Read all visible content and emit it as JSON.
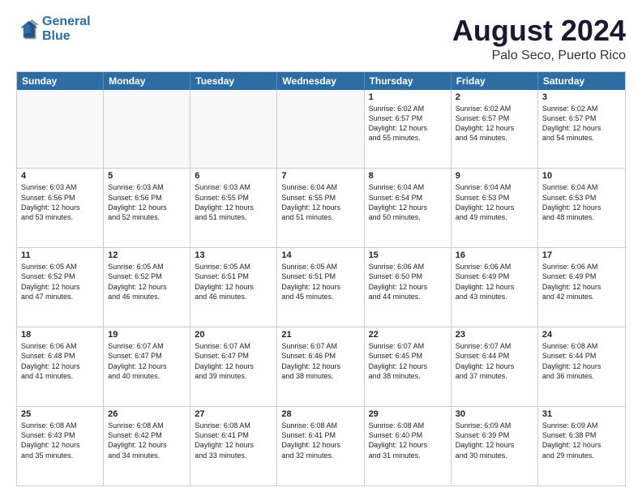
{
  "header": {
    "logo_general": "General",
    "logo_blue": "Blue",
    "title": "August 2024",
    "subtitle": "Palo Seco, Puerto Rico"
  },
  "days_of_week": [
    "Sunday",
    "Monday",
    "Tuesday",
    "Wednesday",
    "Thursday",
    "Friday",
    "Saturday"
  ],
  "weeks": [
    [
      {
        "day": "",
        "empty": true
      },
      {
        "day": "",
        "empty": true
      },
      {
        "day": "",
        "empty": true
      },
      {
        "day": "",
        "empty": true
      },
      {
        "day": "1",
        "line1": "Sunrise: 6:02 AM",
        "line2": "Sunset: 6:57 PM",
        "line3": "Daylight: 12 hours",
        "line4": "and 55 minutes."
      },
      {
        "day": "2",
        "line1": "Sunrise: 6:02 AM",
        "line2": "Sunset: 6:57 PM",
        "line3": "Daylight: 12 hours",
        "line4": "and 54 minutes."
      },
      {
        "day": "3",
        "line1": "Sunrise: 6:02 AM",
        "line2": "Sunset: 6:57 PM",
        "line3": "Daylight: 12 hours",
        "line4": "and 54 minutes."
      }
    ],
    [
      {
        "day": "4",
        "line1": "Sunrise: 6:03 AM",
        "line2": "Sunset: 6:56 PM",
        "line3": "Daylight: 12 hours",
        "line4": "and 53 minutes."
      },
      {
        "day": "5",
        "line1": "Sunrise: 6:03 AM",
        "line2": "Sunset: 6:56 PM",
        "line3": "Daylight: 12 hours",
        "line4": "and 52 minutes."
      },
      {
        "day": "6",
        "line1": "Sunrise: 6:03 AM",
        "line2": "Sunset: 6:55 PM",
        "line3": "Daylight: 12 hours",
        "line4": "and 51 minutes."
      },
      {
        "day": "7",
        "line1": "Sunrise: 6:04 AM",
        "line2": "Sunset: 6:55 PM",
        "line3": "Daylight: 12 hours",
        "line4": "and 51 minutes."
      },
      {
        "day": "8",
        "line1": "Sunrise: 6:04 AM",
        "line2": "Sunset: 6:54 PM",
        "line3": "Daylight: 12 hours",
        "line4": "and 50 minutes."
      },
      {
        "day": "9",
        "line1": "Sunrise: 6:04 AM",
        "line2": "Sunset: 6:53 PM",
        "line3": "Daylight: 12 hours",
        "line4": "and 49 minutes."
      },
      {
        "day": "10",
        "line1": "Sunrise: 6:04 AM",
        "line2": "Sunset: 6:53 PM",
        "line3": "Daylight: 12 hours",
        "line4": "and 48 minutes."
      }
    ],
    [
      {
        "day": "11",
        "line1": "Sunrise: 6:05 AM",
        "line2": "Sunset: 6:52 PM",
        "line3": "Daylight: 12 hours",
        "line4": "and 47 minutes."
      },
      {
        "day": "12",
        "line1": "Sunrise: 6:05 AM",
        "line2": "Sunset: 6:52 PM",
        "line3": "Daylight: 12 hours",
        "line4": "and 46 minutes."
      },
      {
        "day": "13",
        "line1": "Sunrise: 6:05 AM",
        "line2": "Sunset: 6:51 PM",
        "line3": "Daylight: 12 hours",
        "line4": "and 46 minutes."
      },
      {
        "day": "14",
        "line1": "Sunrise: 6:05 AM",
        "line2": "Sunset: 6:51 PM",
        "line3": "Daylight: 12 hours",
        "line4": "and 45 minutes."
      },
      {
        "day": "15",
        "line1": "Sunrise: 6:06 AM",
        "line2": "Sunset: 6:50 PM",
        "line3": "Daylight: 12 hours",
        "line4": "and 44 minutes."
      },
      {
        "day": "16",
        "line1": "Sunrise: 6:06 AM",
        "line2": "Sunset: 6:49 PM",
        "line3": "Daylight: 12 hours",
        "line4": "and 43 minutes."
      },
      {
        "day": "17",
        "line1": "Sunrise: 6:06 AM",
        "line2": "Sunset: 6:49 PM",
        "line3": "Daylight: 12 hours",
        "line4": "and 42 minutes."
      }
    ],
    [
      {
        "day": "18",
        "line1": "Sunrise: 6:06 AM",
        "line2": "Sunset: 6:48 PM",
        "line3": "Daylight: 12 hours",
        "line4": "and 41 minutes."
      },
      {
        "day": "19",
        "line1": "Sunrise: 6:07 AM",
        "line2": "Sunset: 6:47 PM",
        "line3": "Daylight: 12 hours",
        "line4": "and 40 minutes."
      },
      {
        "day": "20",
        "line1": "Sunrise: 6:07 AM",
        "line2": "Sunset: 6:47 PM",
        "line3": "Daylight: 12 hours",
        "line4": "and 39 minutes."
      },
      {
        "day": "21",
        "line1": "Sunrise: 6:07 AM",
        "line2": "Sunset: 6:46 PM",
        "line3": "Daylight: 12 hours",
        "line4": "and 38 minutes."
      },
      {
        "day": "22",
        "line1": "Sunrise: 6:07 AM",
        "line2": "Sunset: 6:45 PM",
        "line3": "Daylight: 12 hours",
        "line4": "and 38 minutes."
      },
      {
        "day": "23",
        "line1": "Sunrise: 6:07 AM",
        "line2": "Sunset: 6:44 PM",
        "line3": "Daylight: 12 hours",
        "line4": "and 37 minutes."
      },
      {
        "day": "24",
        "line1": "Sunrise: 6:08 AM",
        "line2": "Sunset: 6:44 PM",
        "line3": "Daylight: 12 hours",
        "line4": "and 36 minutes."
      }
    ],
    [
      {
        "day": "25",
        "line1": "Sunrise: 6:08 AM",
        "line2": "Sunset: 6:43 PM",
        "line3": "Daylight: 12 hours",
        "line4": "and 35 minutes."
      },
      {
        "day": "26",
        "line1": "Sunrise: 6:08 AM",
        "line2": "Sunset: 6:42 PM",
        "line3": "Daylight: 12 hours",
        "line4": "and 34 minutes."
      },
      {
        "day": "27",
        "line1": "Sunrise: 6:08 AM",
        "line2": "Sunset: 6:41 PM",
        "line3": "Daylight: 12 hours",
        "line4": "and 33 minutes."
      },
      {
        "day": "28",
        "line1": "Sunrise: 6:08 AM",
        "line2": "Sunset: 6:41 PM",
        "line3": "Daylight: 12 hours",
        "line4": "and 32 minutes."
      },
      {
        "day": "29",
        "line1": "Sunrise: 6:08 AM",
        "line2": "Sunset: 6:40 PM",
        "line3": "Daylight: 12 hours",
        "line4": "and 31 minutes."
      },
      {
        "day": "30",
        "line1": "Sunrise: 6:09 AM",
        "line2": "Sunset: 6:39 PM",
        "line3": "Daylight: 12 hours",
        "line4": "and 30 minutes."
      },
      {
        "day": "31",
        "line1": "Sunrise: 6:09 AM",
        "line2": "Sunset: 6:38 PM",
        "line3": "Daylight: 12 hours",
        "line4": "and 29 minutes."
      }
    ]
  ]
}
